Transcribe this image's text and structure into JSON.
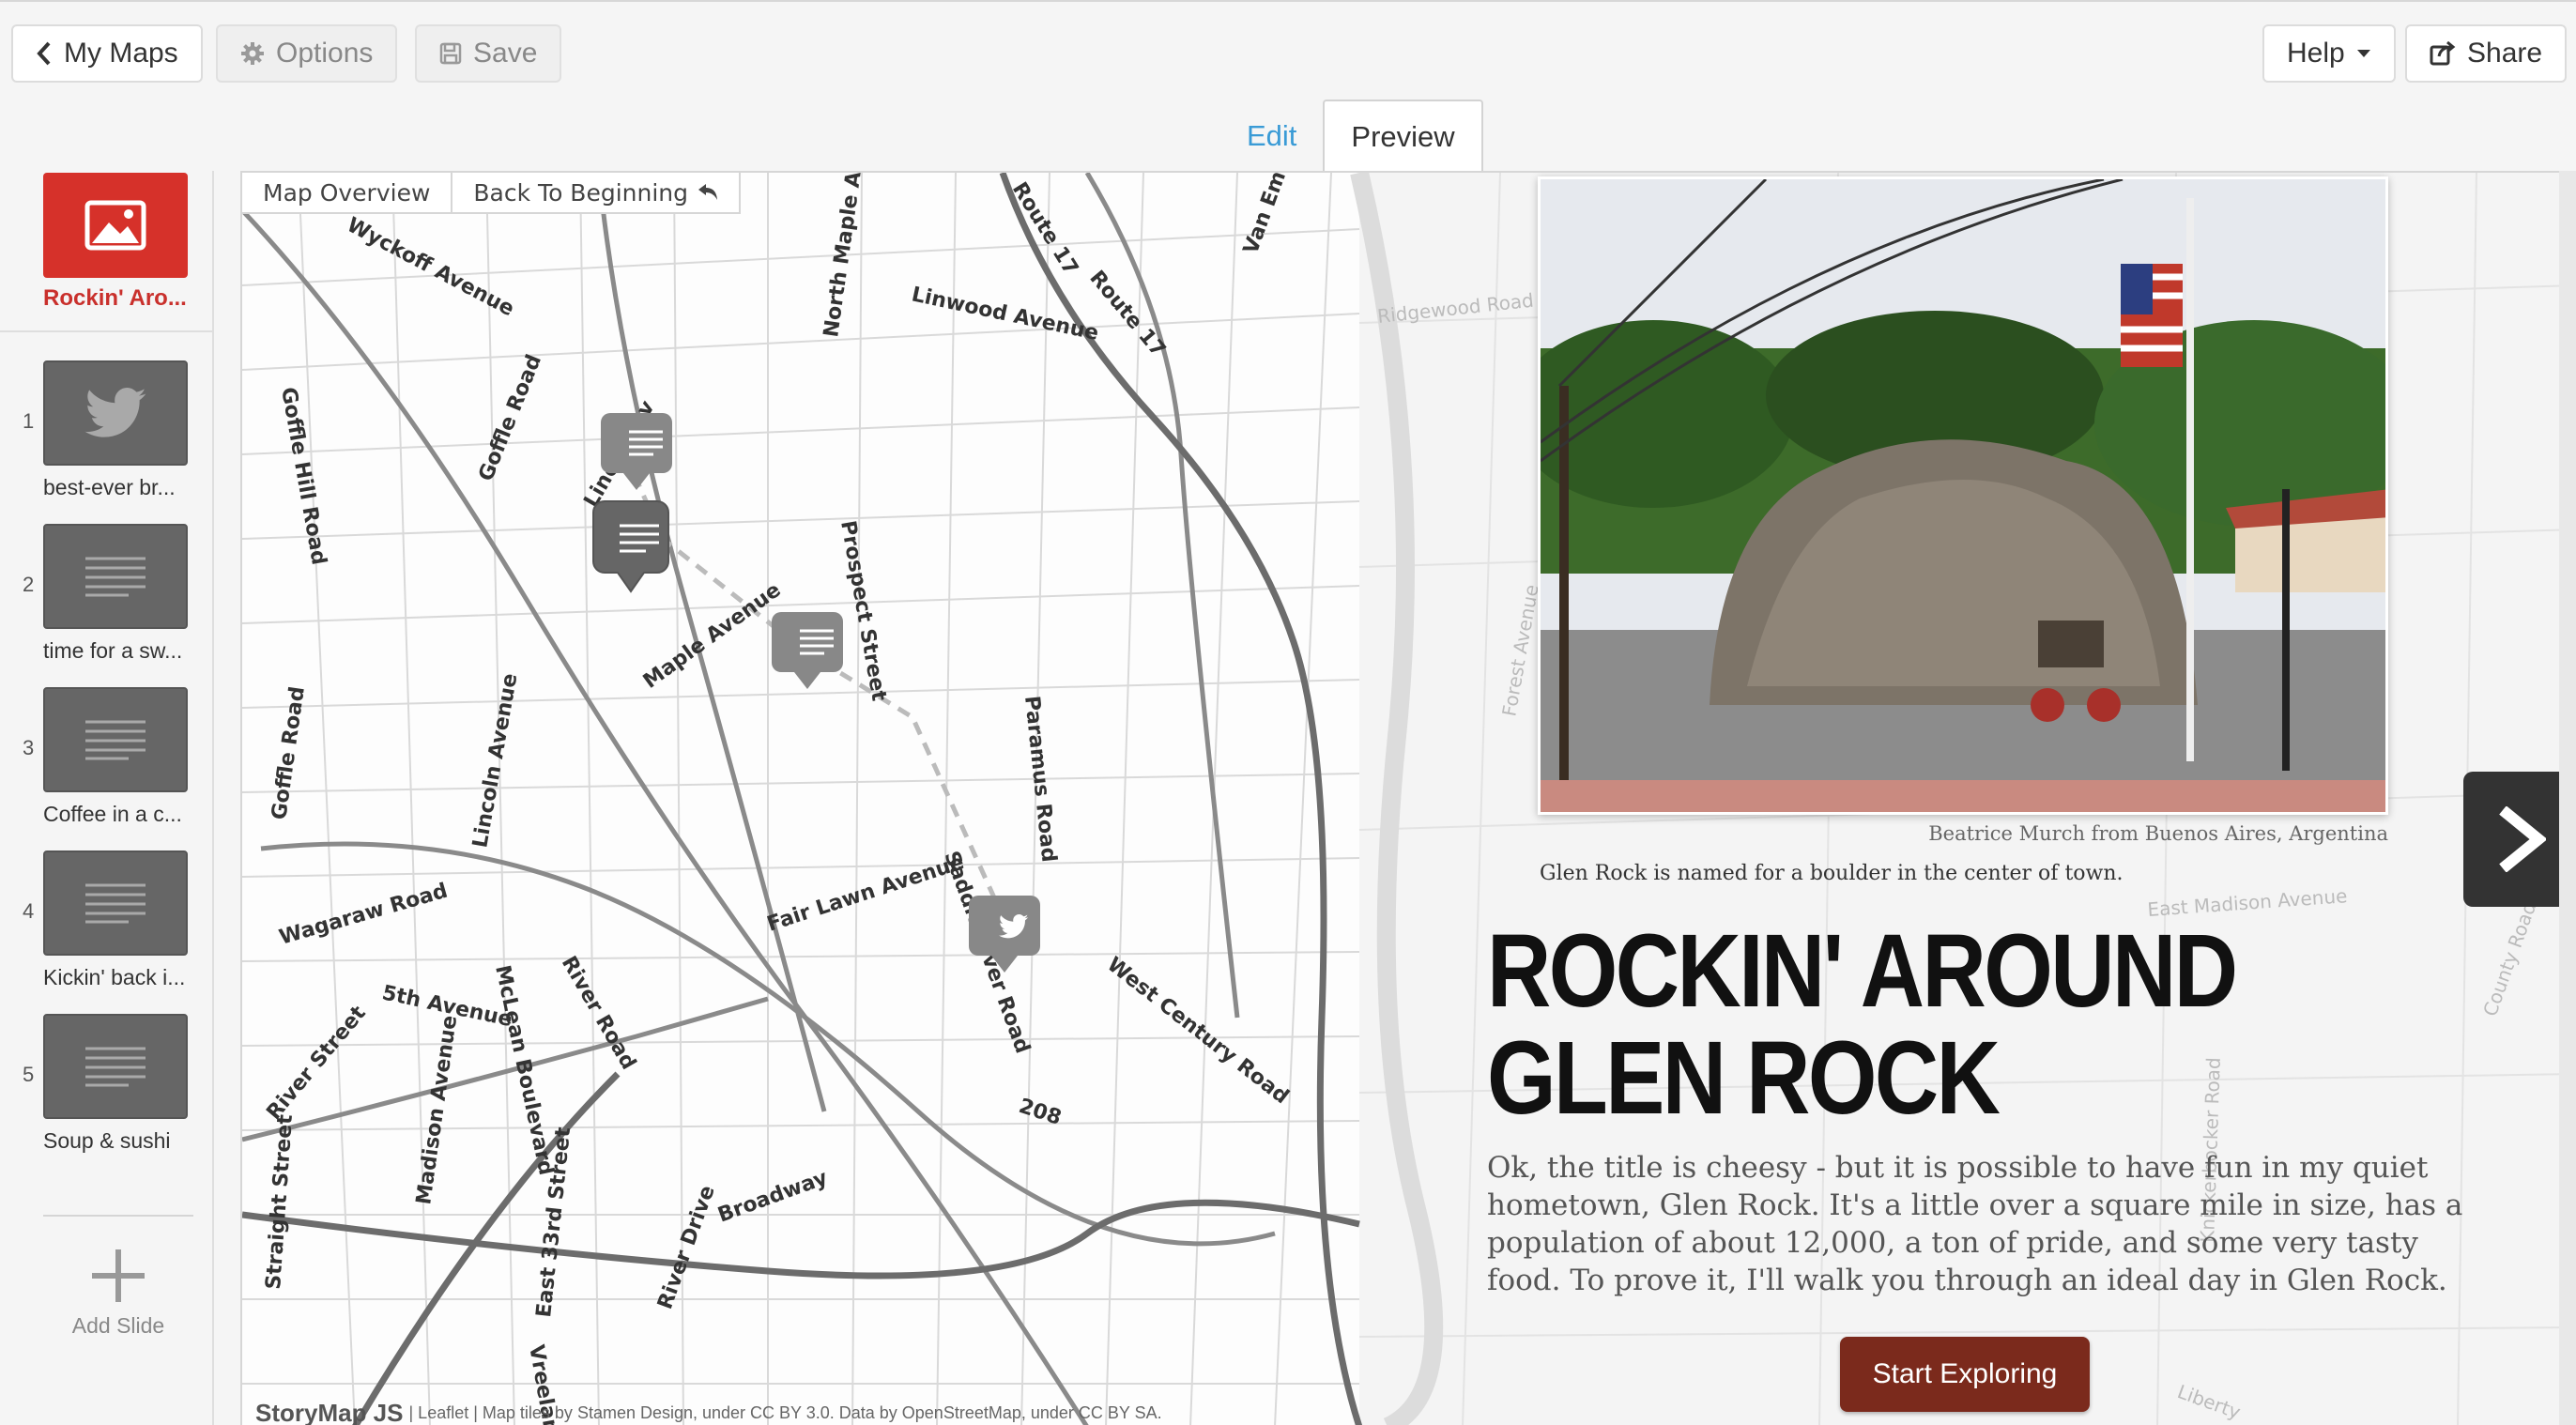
{
  "toolbar": {
    "my_maps": "My Maps",
    "options": "Options",
    "save": "Save",
    "help": "Help",
    "share": "Share"
  },
  "tabs": {
    "edit": "Edit",
    "preview": "Preview"
  },
  "sidebar": {
    "cover_label": "Rockin' Aro...",
    "slides": [
      {
        "num": "1",
        "label": "best-ever br...",
        "icon": "twitter-icon"
      },
      {
        "num": "2",
        "label": "time for a sw...",
        "icon": "text-lines-icon"
      },
      {
        "num": "3",
        "label": "Coffee in a c...",
        "icon": "text-lines-icon"
      },
      {
        "num": "4",
        "label": "Kickin' back i...",
        "icon": "text-lines-icon"
      },
      {
        "num": "5",
        "label": "Soup & sushi",
        "icon": "text-lines-icon"
      }
    ],
    "add_slide": "Add Slide"
  },
  "map": {
    "overview": "Map Overview",
    "back": "Back To Beginning",
    "streets": [
      "Wyckoff Avenue",
      "Goffle Road",
      "Goffle Hill Road",
      "Linwood Avenue",
      "North Maple Av",
      "Route 17",
      "Route 17",
      "Van Emb",
      "Lincoln Av",
      "Maple Avenue",
      "Prospect Street",
      "Paramus Road",
      "Goffle Road",
      "Lincoln Avenue",
      "Wagaraw Road",
      "Fair Lawn Avenue",
      "Saddle River Road",
      "West Century Road",
      "5th Avenue",
      "McLean Boulevard",
      "River Road",
      "River Street",
      "Madison Avenue",
      "208",
      "Broadway",
      "East 33rd Street",
      "River Drive",
      "Straight Street",
      "Vreeland Av",
      "Ridgewood Road",
      "Forest Avenue",
      "East Madison Avenue",
      "Knickerbocker Road",
      "County Road",
      "Liberty"
    ],
    "attribution_brand": "StoryMap JS",
    "attribution_text": "| Leaflet | Map tiles by Stamen Design, under CC BY 3.0. Data by OpenStreetMap, under CC BY SA."
  },
  "slide": {
    "photo_alt": "Glen Rock boulder monument with flag pole",
    "credit": "Beatrice Murch from Buenos Aires, Argentina",
    "caption": "Glen Rock is named for a boulder in the center of town.",
    "title": "ROCKIN' AROUND GLEN ROCK",
    "description": "Ok, the title is cheesy - but it is possible to have fun in my quiet hometown, Glen Rock. It's a little over a square mile in size, has a population of about 12,000, a ton of pride, and some very tasty food. To prove it, I'll walk you through an ideal day in Glen Rock.",
    "cta": "Start Exploring"
  },
  "colors": {
    "accent_red": "#d6312a",
    "cta_brown": "#7b2a1c",
    "link_blue": "#3a9bd6"
  }
}
